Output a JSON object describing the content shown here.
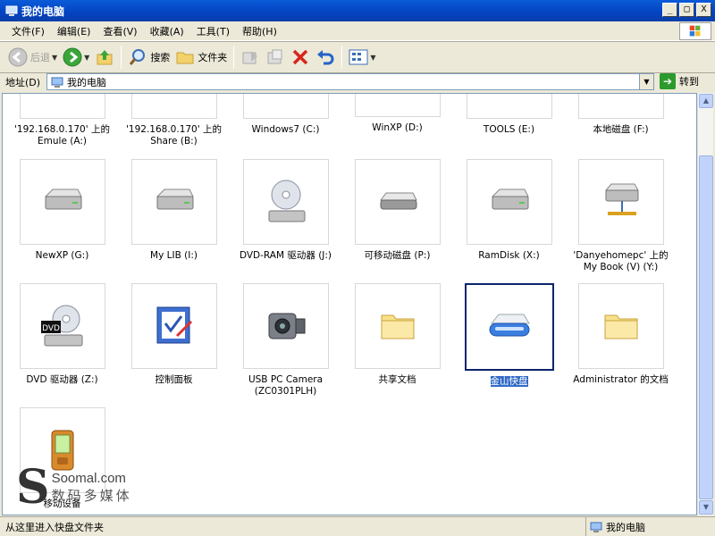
{
  "window": {
    "title": "我的电脑",
    "buttons": [
      "_",
      "□",
      "X"
    ]
  },
  "menu": [
    "文件(F)",
    "编辑(E)",
    "查看(V)",
    "收藏(A)",
    "工具(T)",
    "帮助(H)"
  ],
  "toolbar": {
    "back": "后退",
    "search": "搜索",
    "folders": "文件夹"
  },
  "address": {
    "label": "地址(D)",
    "value": "我的电脑",
    "go": "转到"
  },
  "top_row": [
    {
      "name": "'192.168.0.170' 上的 Emule (A:)"
    },
    {
      "name": "'192.168.0.170' 上的 Share (B:)"
    },
    {
      "name": "Windows7 (C:)"
    },
    {
      "name": "WinXP (D:)"
    },
    {
      "name": "TOOLS (E:)"
    },
    {
      "name": "本地磁盘 (F:)"
    }
  ],
  "row2": [
    {
      "name": "NewXP (G:)",
      "icon": "hard-drive-icon"
    },
    {
      "name": "My LIB (I:)",
      "icon": "hard-drive-icon"
    },
    {
      "name": "DVD-RAM 驱动器 (J:)",
      "icon": "dvd-drive-icon"
    },
    {
      "name": "可移动磁盘 (P:)",
      "icon": "removable-disk-icon"
    },
    {
      "name": "RamDisk (X:)",
      "icon": "hard-drive-icon"
    },
    {
      "name": "'Danyehomepc' 上的 My Book (V) (Y:)",
      "icon": "network-drive-icon"
    }
  ],
  "row3": [
    {
      "name": "DVD 驱动器 (Z:)",
      "icon": "dvd-drive-icon"
    },
    {
      "name": "控制面板",
      "icon": "control-panel-icon"
    },
    {
      "name": "USB PC Camera (ZC0301PLH)",
      "icon": "camera-icon"
    },
    {
      "name": "共享文档",
      "icon": "folder-icon"
    },
    {
      "name": "金山快盘",
      "icon": "kuaipan-drive-icon"
    },
    {
      "name": "Administrator 的文档",
      "icon": "folder-icon"
    }
  ],
  "row4": [
    {
      "name": "移动设备",
      "icon": "mobile-device-icon"
    }
  ],
  "status": {
    "left": "从这里进入快盘文件夹",
    "right": "我的电脑"
  },
  "watermark": {
    "line1": "Soomal.com",
    "line2": "数码多媒体"
  }
}
